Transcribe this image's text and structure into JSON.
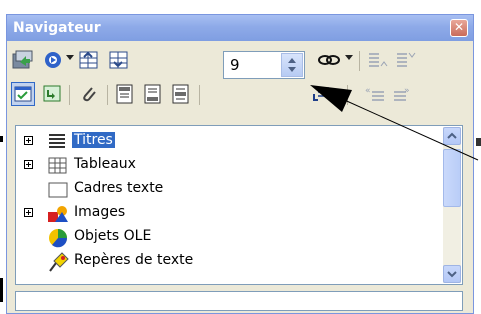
{
  "window": {
    "title": "Navigateur"
  },
  "toolbar": {
    "entry_level_value": "9"
  },
  "tree": {
    "items": [
      {
        "label": "Titres",
        "icon": "headings-icon",
        "expandable": true,
        "selected": true
      },
      {
        "label": "Tableaux",
        "icon": "table-icon",
        "expandable": true,
        "selected": false
      },
      {
        "label": "Cadres texte",
        "icon": "text-frame-icon",
        "expandable": false,
        "selected": false
      },
      {
        "label": "Images",
        "icon": "images-icon",
        "expandable": true,
        "selected": false
      },
      {
        "label": "Objets OLE",
        "icon": "ole-objects-icon",
        "expandable": false,
        "selected": false
      },
      {
        "label": "Repères de texte",
        "icon": "bookmark-icon",
        "expandable": false,
        "selected": false
      }
    ]
  },
  "colors": {
    "selection": "#316ac5",
    "titlebar": "#8eaae8",
    "window_bg": "#ece9d8"
  }
}
